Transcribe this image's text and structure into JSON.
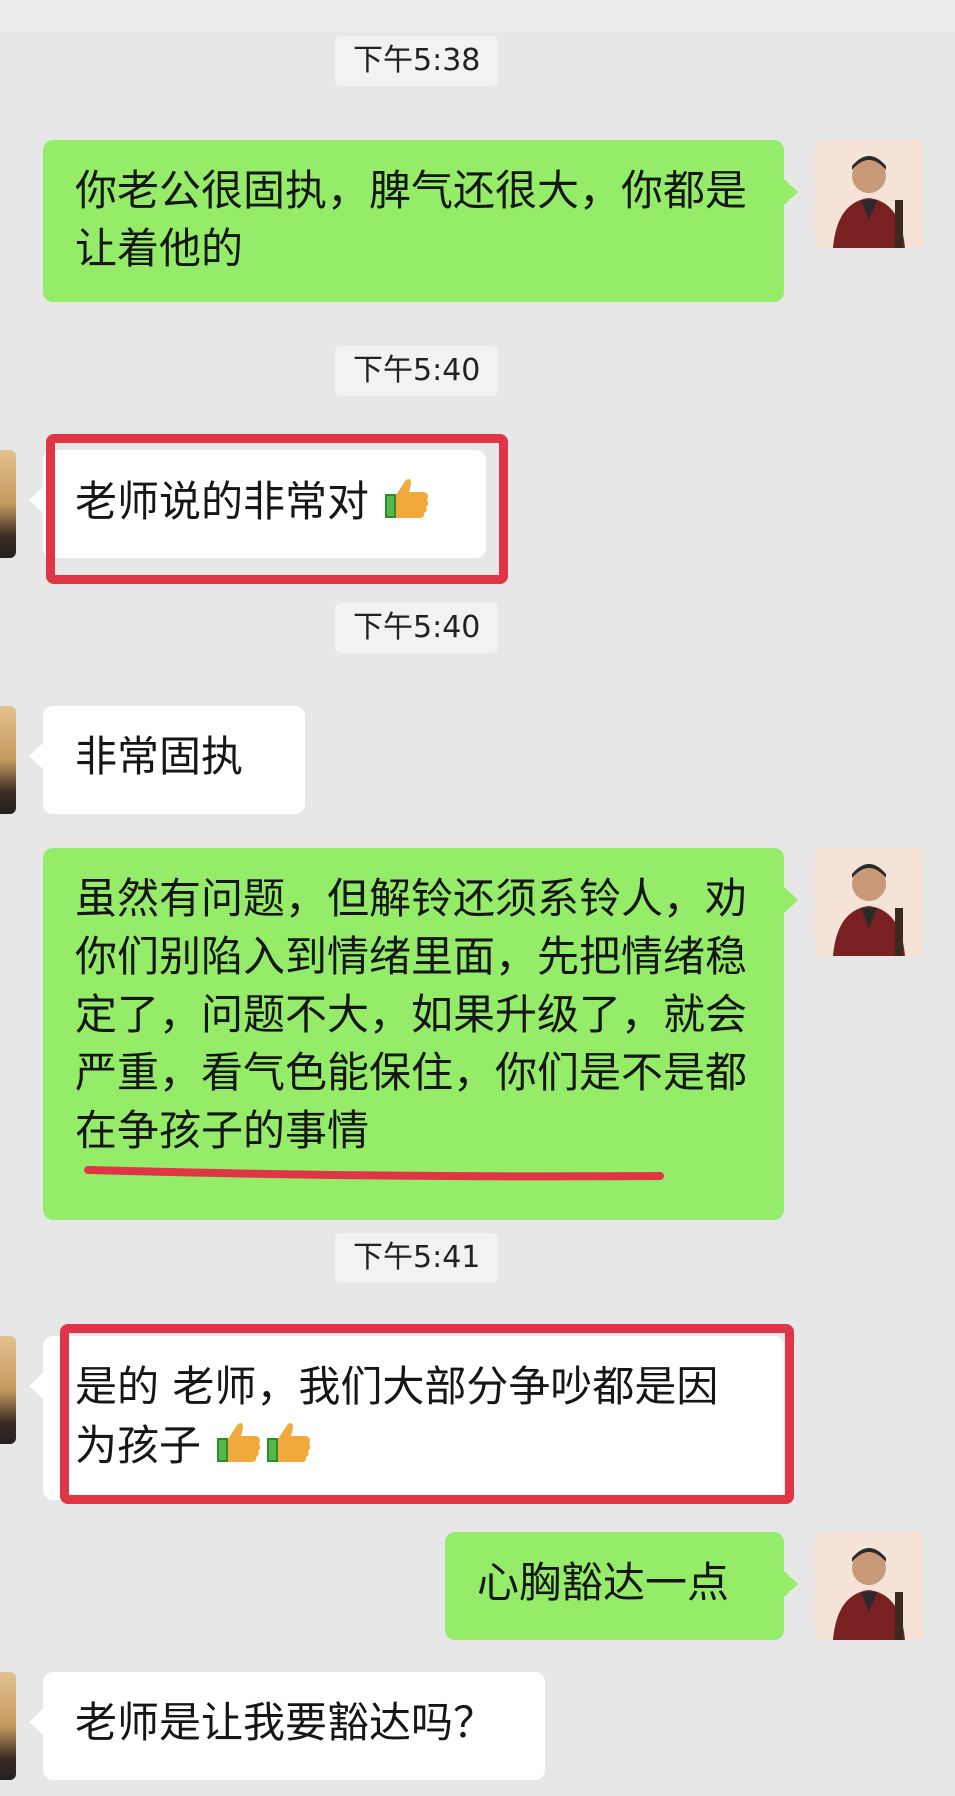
{
  "messages": {
    "t1": "下午5:38",
    "m1": "你老公很固执，脾气还很大，你都是让着他的",
    "t2": "下午5:40",
    "m2": "老师说的非常对",
    "t3": "下午5:40",
    "m3": "非常固执",
    "m4": "虽然有问题，但解铃还须系铃人，劝你们别陷入到情绪里面，先把情绪稳定了，问题不大，如果升级了，就会严重，看气色能保住，你们是不是都在争孩子的事情",
    "t4": "下午5:41",
    "m5": "是的 老师，我们大部分争吵都是因为孩子",
    "m6": "心胸豁达一点",
    "m7": "老师是让我要豁达吗？"
  },
  "icons": {
    "thumbs_up": "thumbs-up-emoji",
    "avatar_self": "man-in-red-blazer-photo",
    "avatar_other": "cropped-contact-photo"
  },
  "colors": {
    "self_bubble": "#95ec69",
    "other_bubble": "#ffffff",
    "highlight": "#e03546"
  }
}
